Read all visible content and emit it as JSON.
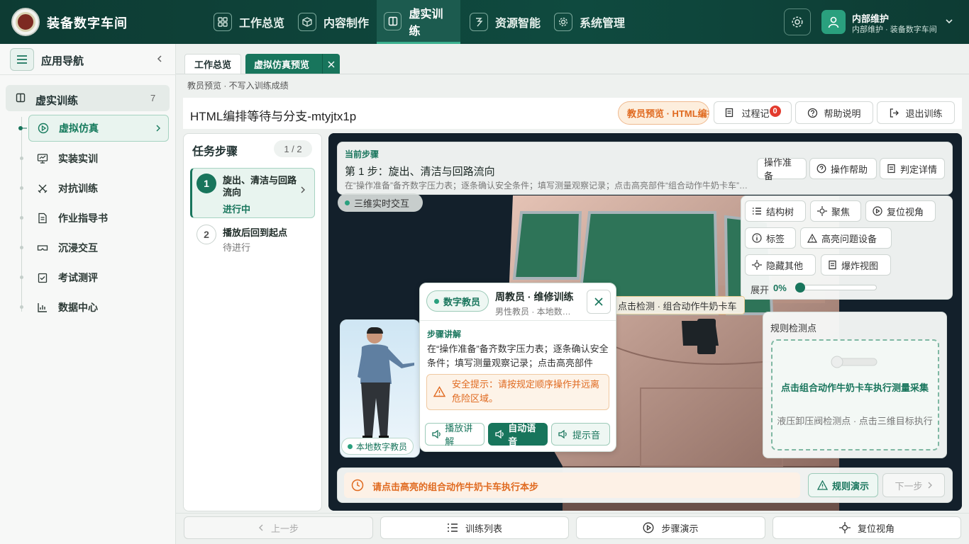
{
  "header": {
    "brand": "装备数字车间",
    "nav": [
      "工作总览",
      "内容制作",
      "虚实训练",
      "资源智能",
      "系统管理"
    ],
    "user_name": "内部维护",
    "user_sub": "内部维护 · 装备数字车间"
  },
  "sidebar": {
    "title": "应用导航",
    "group": "虚实训练",
    "group_count": "7",
    "items": [
      "虚拟仿真",
      "实装实训",
      "对抗训练",
      "作业指导书",
      "沉浸交互",
      "考试测评",
      "数据中心"
    ]
  },
  "tabs": {
    "tab1": "工作总览",
    "tab2": "虚拟仿真预览"
  },
  "breadcrumb": "教员预览 · 不写入训练成绩",
  "page": {
    "title": "HTML编排等待与分支-mtyjtx1p",
    "mode_pill": "教员预览 · HTML编排",
    "record_label": "过程记",
    "record_badge": "0",
    "help": "帮助说明",
    "exit": "退出训练"
  },
  "tasks": {
    "title": "任务步骤",
    "count": "1 / 2",
    "steps": [
      {
        "num": "1",
        "title": "旋出、清洁与回路流向",
        "status": "进行中"
      },
      {
        "num": "2",
        "title": "播放后回到起点",
        "status": "待进行"
      }
    ]
  },
  "current": {
    "label": "当前步骤",
    "title": "第 1 步：旋出、清洁与回路流向",
    "desc": "在“操作准备”备齐数字压力表；逐条确认安全条件；填写测量观察记录；点击高亮部件“组合动作牛奶卡车”执行",
    "btn_prep": "操作准备",
    "btn_help": "操作帮助",
    "btn_judge": "判定详情"
  },
  "scene": {
    "mode_chip": "三维实时交互",
    "hint_label": "点击检测 · 组合动作牛奶卡车",
    "tools": [
      "结构树",
      "聚焦",
      "复位视角",
      "标签",
      "高亮问题设备",
      "隐藏其他",
      "爆炸视图"
    ],
    "expand_label": "展开",
    "expand_value": "0%",
    "expand_level": 0
  },
  "instructor": {
    "chip": "数字教员",
    "name": "周教员 · 维修训练",
    "sub": "男性教员 · 本地数字教员",
    "local_chip": "本地数字教员",
    "section": "步骤讲解",
    "text": "在“操作准备”备齐数字压力表；逐条确认安全条件；填写测量观察记录；点击高亮部件",
    "safety": "安全提示：请按规定顺序操作并远离危险区域。",
    "btn_play": "播放讲解",
    "btn_auto": "自动语音",
    "btn_tone": "提示音"
  },
  "rule": {
    "title": "规则检测点",
    "main": "点击组合动作牛奶卡车执行测量采集",
    "sub": "液压卸压阀检测点 · 点击三维目标执行"
  },
  "footer_hint": {
    "text": "请点击高亮的组合动作牛奶卡车执行本步",
    "btn_demo": "规则演示",
    "btn_next": "下一步"
  },
  "bottom": {
    "prev": "上一步",
    "list": "训练列表",
    "demo": "步骤演示",
    "reset": "复位视角"
  },
  "colors": {
    "primary": "#18755c",
    "header": "#0f4a3f",
    "accent": "#e06a20"
  }
}
